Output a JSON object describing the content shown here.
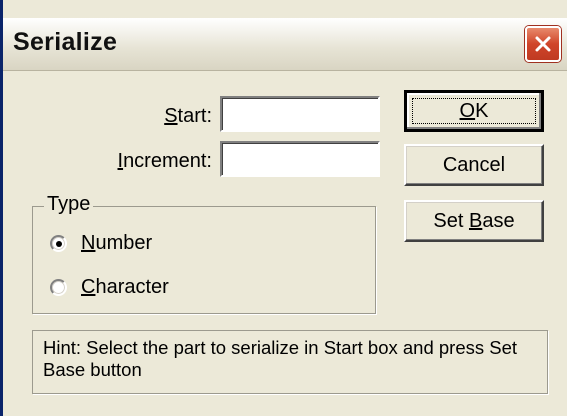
{
  "window": {
    "title": "Serialize"
  },
  "fields": {
    "start_label_pre": "",
    "start_label_accel": "S",
    "start_label_post": "tart:",
    "start_value": "",
    "increment_label_pre": "",
    "increment_label_accel": "I",
    "increment_label_post": "ncrement:",
    "increment_value": ""
  },
  "buttons": {
    "ok_pre": "",
    "ok_accel": "O",
    "ok_post": "K",
    "cancel_label": "Cancel",
    "setbase_pre": "Set ",
    "setbase_accel": "B",
    "setbase_post": "ase"
  },
  "type_group": {
    "title": "Type",
    "options": [
      {
        "pre": "",
        "accel": "N",
        "post": "umber",
        "selected": true
      },
      {
        "pre": "",
        "accel": "C",
        "post": "haracter",
        "selected": false
      }
    ]
  },
  "hint": {
    "text": "Hint: Select the part to serialize in Start box and press Set Base button"
  },
  "colors": {
    "dialog_bg": "#ece9d8",
    "close_button": "#d0452a"
  }
}
